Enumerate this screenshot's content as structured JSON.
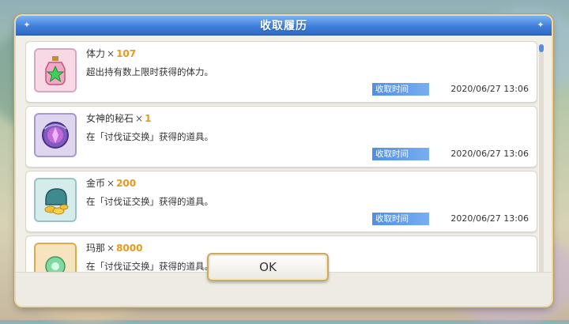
{
  "dialog": {
    "title": "收取履历",
    "ok_label": "OK",
    "items": [
      {
        "icon": "stamina-potion-icon",
        "name": "体力",
        "x": "×",
        "qty": "107",
        "desc": "超出持有数上限时获得的体力。",
        "time_label": "收取时间",
        "time": "2020/06/27 13:06"
      },
      {
        "icon": "goddess-stone-icon",
        "name": "女神的秘石",
        "x": "×",
        "qty": "1",
        "desc": "在「讨伐证交换」获得的道具。",
        "time_label": "收取时间",
        "time": "2020/06/27 13:06"
      },
      {
        "icon": "gold-coin-icon",
        "name": "金币",
        "x": "×",
        "qty": "200",
        "desc": "在「讨伐证交换」获得的道具。",
        "time_label": "收取时间",
        "time": "2020/06/27 13:06"
      },
      {
        "icon": "mana-icon",
        "name": "玛那",
        "x": "×",
        "qty": "8000",
        "desc": "在「讨伐证交换」获得的道具。",
        "time_label": "",
        "time": ""
      }
    ]
  },
  "colors": {
    "title_bar": "#3f7fdb",
    "qty": "#e69a1c",
    "time_label": "#4f8fe6"
  }
}
